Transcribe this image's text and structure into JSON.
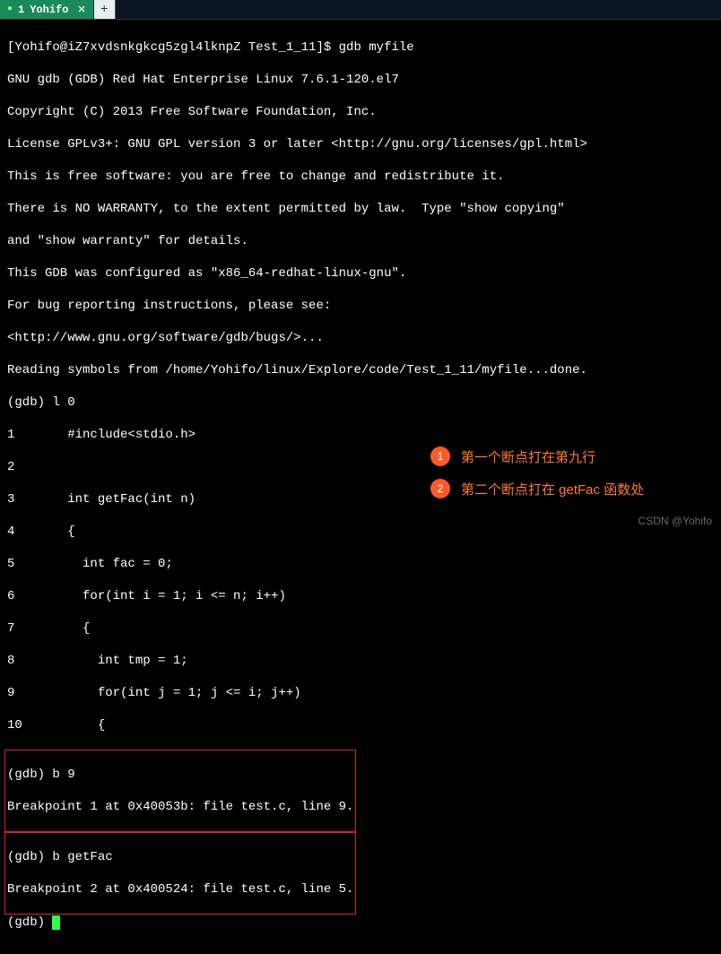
{
  "titlebar": {
    "tab_index": "1",
    "tab_label": "Yohifo",
    "newtab_label": "+"
  },
  "terminal": {
    "prompt_line": "[Yohifo@iZ7xvdsnkgkcg5zgl4lknpZ Test_1_11]$ gdb myfile",
    "banner": [
      "GNU gdb (GDB) Red Hat Enterprise Linux 7.6.1-120.el7",
      "Copyright (C) 2013 Free Software Foundation, Inc.",
      "License GPLv3+: GNU GPL version 3 or later <http://gnu.org/licenses/gpl.html>",
      "This is free software: you are free to change and redistribute it.",
      "There is NO WARRANTY, to the extent permitted by law.  Type \"show copying\"",
      "and \"show warranty\" for details.",
      "This GDB was configured as \"x86_64-redhat-linux-gnu\".",
      "For bug reporting instructions, please see:",
      "<http://www.gnu.org/software/gdb/bugs/>...",
      "Reading symbols from /home/Yohifo/linux/Explore/code/Test_1_11/myfile...done."
    ],
    "gdb_list_cmd": "(gdb) l 0",
    "source": [
      "1       #include<stdio.h>",
      "2",
      "3       int getFac(int n)",
      "4       {",
      "5         int fac = 0;",
      "6         for(int i = 1; i <= n; i++)",
      "7         {",
      "8           int tmp = 1;",
      "9           for(int j = 1; j <= i; j++)",
      "10          {"
    ],
    "box1": [
      "(gdb) b 9",
      "Breakpoint 1 at 0x40053b: file test.c, line 9."
    ],
    "box2": [
      "(gdb) b getFac",
      "Breakpoint 2 at 0x400524: file test.c, line 5."
    ],
    "final_prompt": "(gdb) "
  },
  "annotations": {
    "a1_num": "1",
    "a1_text": "第一个断点打在第九行",
    "a2_num": "2",
    "a2_text": "第二个断点打在 getFac 函数处"
  },
  "watermark": "CSDN @Yohifo"
}
